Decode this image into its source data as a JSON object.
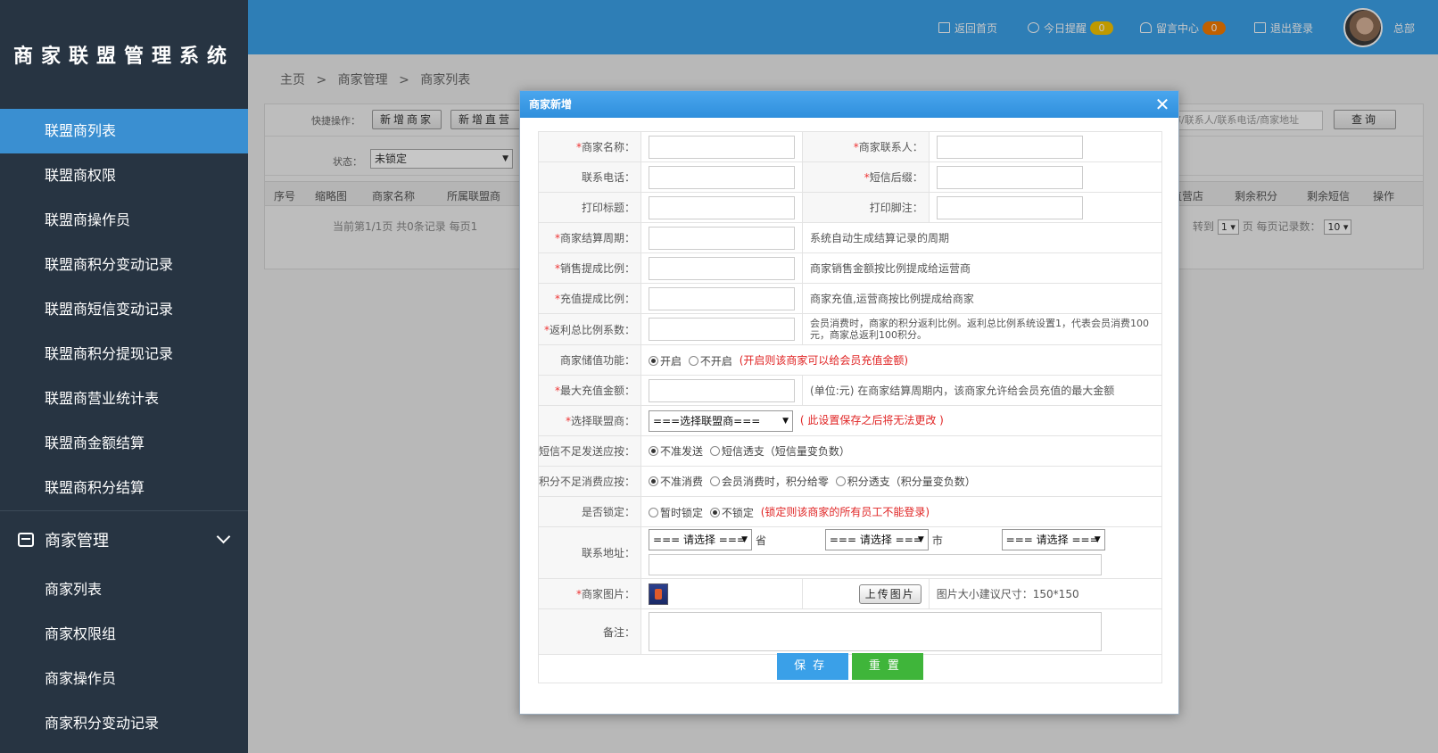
{
  "app": {
    "logo_text": "商家联盟管理系统"
  },
  "sidebar": {
    "group1": [
      {
        "label": "联盟商列表",
        "active": true
      },
      {
        "label": "联盟商权限"
      },
      {
        "label": "联盟商操作员"
      },
      {
        "label": "联盟商积分变动记录"
      },
      {
        "label": "联盟商短信变动记录"
      },
      {
        "label": "联盟商积分提现记录"
      },
      {
        "label": "联盟商营业统计表"
      },
      {
        "label": "联盟商金额结算"
      },
      {
        "label": "联盟商积分结算"
      }
    ],
    "section": {
      "label": "商家管理",
      "icon": "store-icon",
      "expanded": true
    },
    "group2": [
      {
        "label": "商家列表"
      },
      {
        "label": "商家权限组"
      },
      {
        "label": "商家操作员"
      },
      {
        "label": "商家积分变动记录"
      }
    ]
  },
  "topbar": {
    "home": "返回首页",
    "reminder": "今日提醒",
    "reminder_count": "0",
    "messages": "留言中心",
    "messages_count": "0",
    "logout": "退出登录",
    "user": "总部",
    "colors": {
      "bar": "#3ca2ea",
      "reminder_badge": "#f5c400",
      "messages_badge": "#f57c00"
    }
  },
  "background": {
    "breadcrumb": [
      "主页",
      ">",
      "商家管理",
      ">",
      "商家列表"
    ],
    "quick_label": "快捷操作：",
    "quick_buttons": [
      "新增商家",
      "新增直营"
    ],
    "status_label": "状态：",
    "status_value": "未锁定",
    "search_placeholder": "名称/联系人/联系电话/商家地址",
    "search_button": "查询",
    "columns_left": [
      "序号",
      "缩略图",
      "商家名称",
      "所属联盟商"
    ],
    "columns_right": [
      "家/直营店",
      "剩余积分",
      "剩余短信",
      "操作"
    ],
    "pager_text": "当前第1/1页 共0条记录 每页1",
    "pager_last": "页",
    "pager_goto": "转到",
    "pager_page": "1",
    "pager_per_page_label": "页 每页记录数：",
    "pager_per_page": "10"
  },
  "modal": {
    "title": "商家新增",
    "close_icon": "close-icon",
    "fields": {
      "name": "商家名称：",
      "contact": "商家联系人：",
      "phone": "联系电话：",
      "sms_suffix": "短信后缀：",
      "print_title": "打印标题：",
      "print_footer": "打印脚注：",
      "settle_cycle": "商家结算周期：",
      "settle_cycle_hint": "系统自动生成结算记录的周期",
      "sales_ratio": "销售提成比例：",
      "sales_ratio_hint": "商家销售金额按比例提成给运营商",
      "recharge_ratio": "充值提成比例：",
      "recharge_ratio_hint": "商家充值,运营商按比例提成给商家",
      "rebate_ratio": "返利总比例系数：",
      "rebate_ratio_hint": "会员消费时，商家的积分返利比例。返利总比例系统设置1，代表会员消费100元，商家总返利100积分。",
      "stored_value": "商家储值功能：",
      "stored_value_on": "开启",
      "stored_value_off": "不开启",
      "stored_value_warn": "(开启则该商家可以给会员充值金额)",
      "max_recharge": "最大充值金额：",
      "max_recharge_hint": "(单位:元) 在商家结算周期内，该商家允许给会员充值的最大金额",
      "alliance": "选择联盟商：",
      "alliance_value": "===选择联盟商===",
      "alliance_warn": "( 此设置保存之后将无法更改 )",
      "sms_short": "短信不足发送应按：",
      "sms_short_opt1": "不准发送",
      "sms_short_opt2": "短信透支（短信量变负数）",
      "points_short": "积分不足消费应按：",
      "points_short_opt1": "不准消费",
      "points_short_opt2": "会员消费时，积分给零",
      "points_short_opt3": "积分透支（积分量变负数）",
      "locked": "是否锁定：",
      "locked_opt1": "暂时锁定",
      "locked_opt2": "不锁定",
      "locked_warn": "(锁定则该商家的所有员工不能登录)",
      "address": "联系地址：",
      "province_value": "=== 请选择 ===",
      "province_unit": "省",
      "city_value": "=== 请选择 ===",
      "city_unit": "市",
      "district_value": "=== 请选择 ===",
      "picture": "商家图片：",
      "upload": "上传图片",
      "picture_hint": "图片大小建议尺寸：150*150",
      "remark": "备注："
    },
    "save": "保存",
    "reset": "重置"
  }
}
